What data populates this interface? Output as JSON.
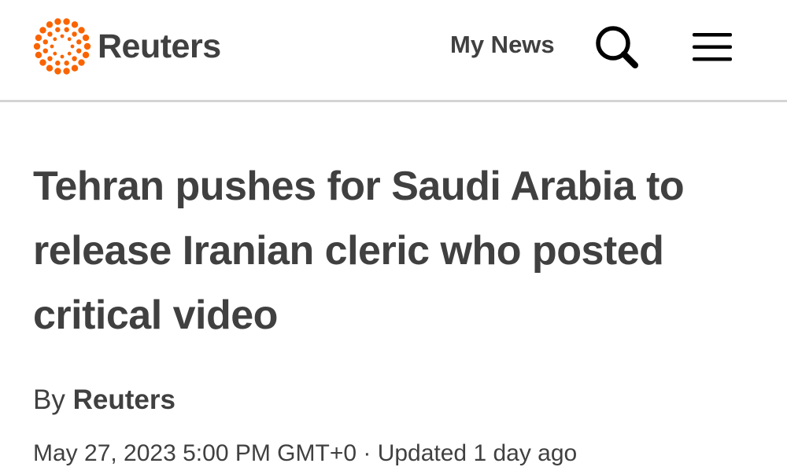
{
  "header": {
    "brand": "Reuters",
    "brand_color": "#fa6400",
    "my_news_label": "My News",
    "search_icon": "search-icon",
    "menu_icon": "hamburger-menu-icon"
  },
  "article": {
    "headline": "Tehran pushes for Saudi Arabia to release Iranian cleric who posted critical video",
    "byline_prefix": "By",
    "byline_author": "Reuters",
    "dateline": "May 27, 2023 5:00 PM GMT+0 · Updated 1 day ago"
  }
}
